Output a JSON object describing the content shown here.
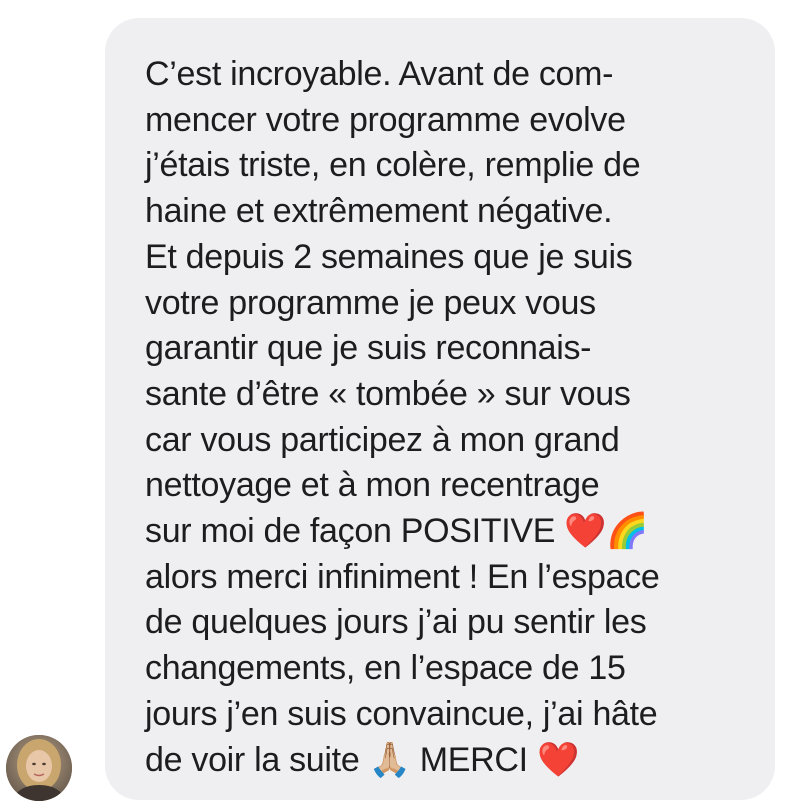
{
  "message": {
    "lines": [
      "C’est incroyable. Avant de com-",
      "mencer votre programme evolve",
      "j’étais triste, en colère, remplie de",
      "haine et extrêmement négative.",
      "Et depuis 2 semaines que je suis",
      "votre programme je peux vous",
      "garantir que je suis reconnais-",
      "sante d’être « tombée » sur vous",
      "car vous participez à mon grand",
      "nettoyage et à mon recentrage",
      "sur moi de façon POSITIVE ❤️🌈",
      "alors merci infiniment ! En l’espace",
      "de quelques jours j’ai pu sentir les",
      "changements, en l’espace de 15",
      "jours j’en suis convaincue, j’ai hâte",
      "de voir la suite 🙏🏼 MERCI ❤️"
    ]
  },
  "sender": {
    "avatar_icon": "user-avatar-photo"
  },
  "colors": {
    "bubble_background": "#efeff1",
    "text": "#1d1d1f",
    "page_background": "#ffffff"
  }
}
